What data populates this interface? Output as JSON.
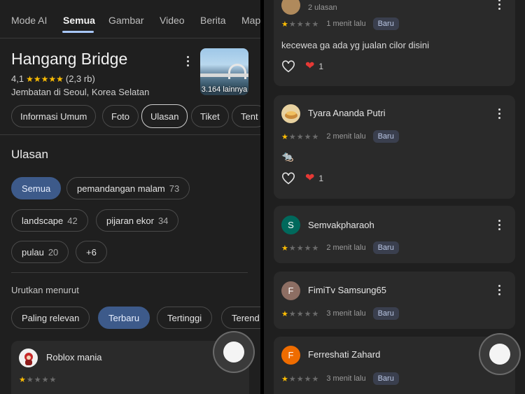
{
  "left": {
    "top_tabs": [
      "Mode AI",
      "Semua",
      "Gambar",
      "Video",
      "Berita",
      "Map"
    ],
    "place": {
      "title": "Hangang Bridge",
      "rating": "4,1",
      "stars": "★★★★★",
      "review_count": "(2,3 rb)",
      "subtitle": "Jembatan di Seoul, Korea Selatan",
      "photo_count": "3.164 lainnya"
    },
    "nav_chips": [
      "Informasi Umum",
      "Foto",
      "Ulasan",
      "Tiket",
      "Tent"
    ],
    "reviews_title": "Ulasan",
    "topic_chips": [
      {
        "label": "Semua",
        "count": ""
      },
      {
        "label": "pemandangan malam",
        "count": "73"
      },
      {
        "label": "landscape",
        "count": "42"
      },
      {
        "label": "pijaran ekor",
        "count": "34"
      },
      {
        "label": "pulau",
        "count": "20"
      },
      {
        "label": "+6",
        "count": ""
      }
    ],
    "sort_label": "Urutkan menurut",
    "sort_chips": [
      "Paling relevan",
      "Terbaru",
      "Tertinggi",
      "Terend"
    ],
    "first_review": {
      "name": "Roblox mania",
      "stars_filled": "★",
      "stars_empty": "★★★★"
    }
  },
  "right": {
    "reviews": [
      {
        "name": "",
        "sub": "2 ulasan",
        "avatar": "",
        "avatar_color": "#b08a5c",
        "time": "1 menit lalu",
        "badge": "Baru",
        "text": "kecewea ga ada yg jualan cilor disini",
        "likes": "1",
        "stars_filled": "★",
        "stars_empty": "★★★★"
      },
      {
        "name": "Tyara Ananda Putri",
        "sub": "",
        "avatar": "",
        "avatar_color": "#c9a45a",
        "time": "2 menit lalu",
        "badge": "Baru",
        "text": "🐀",
        "likes": "1",
        "stars_filled": "★",
        "stars_empty": "★★★★"
      },
      {
        "name": "Semvakpharaoh",
        "sub": "",
        "avatar": "S",
        "avatar_color": "#00695c",
        "time": "2 menit lalu",
        "badge": "Baru",
        "text": "",
        "likes": "",
        "stars_filled": "★",
        "stars_empty": "★★★★"
      },
      {
        "name": "FimiTv Samsung65",
        "sub": "",
        "avatar": "F",
        "avatar_color": "#8d6e63",
        "time": "3 menit lalu",
        "badge": "Baru",
        "text": "",
        "likes": "",
        "stars_filled": "★",
        "stars_empty": "★★★★"
      },
      {
        "name": "Ferreshati Zahard",
        "sub": "",
        "avatar": "F",
        "avatar_color": "#ef6c00",
        "time": "3 menit lalu",
        "badge": "Baru",
        "text": "",
        "likes": "",
        "stars_filled": "★",
        "stars_empty": "★★★★"
      }
    ]
  }
}
